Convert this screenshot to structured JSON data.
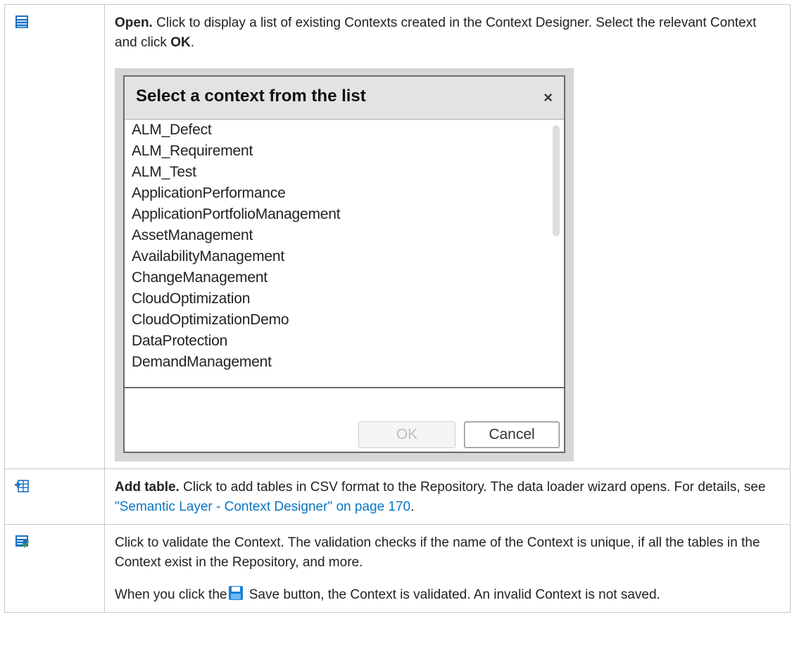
{
  "rows": [
    {
      "icon": "open-context-icon",
      "bold": "Open.",
      "text1": " Click to display a list of existing Contexts created in the Context Designer. Select the relevant Context and click ",
      "bold2": "OK",
      "end": "."
    },
    {
      "icon": "add-table-icon",
      "bold": "Add table.",
      "text1": " Click to add tables in CSV format to the Repository. The data loader wizard opens. For details, see ",
      "link": "\"Semantic Layer - Context Designer\" on page 170",
      "end": "."
    },
    {
      "icon": "validate-context-icon",
      "para1": "Click to validate the Context. The validation checks if the name of the Context is unique, if all the tables in the Context exist in the Repository, and more.",
      "para2_before": "When you click the",
      "para2_after": " Save button, the Context is validated. An invalid Context is not saved."
    }
  ],
  "dialog": {
    "title": "Select a context from the list",
    "close": "×",
    "items": [
      "ALM_Defect",
      "ALM_Requirement",
      "ALM_Test",
      "ApplicationPerformance",
      "ApplicationPortfolioManagement",
      "AssetManagement",
      "AvailabilityManagement",
      "ChangeManagement",
      "CloudOptimization",
      "CloudOptimizationDemo",
      "DataProtection",
      "DemandManagement"
    ],
    "ok_label": "OK",
    "cancel_label": "Cancel"
  },
  "colors": {
    "link": "#0a76c2",
    "icon_blue": "#1a6fc0",
    "icon_green": "#3aa14a"
  }
}
